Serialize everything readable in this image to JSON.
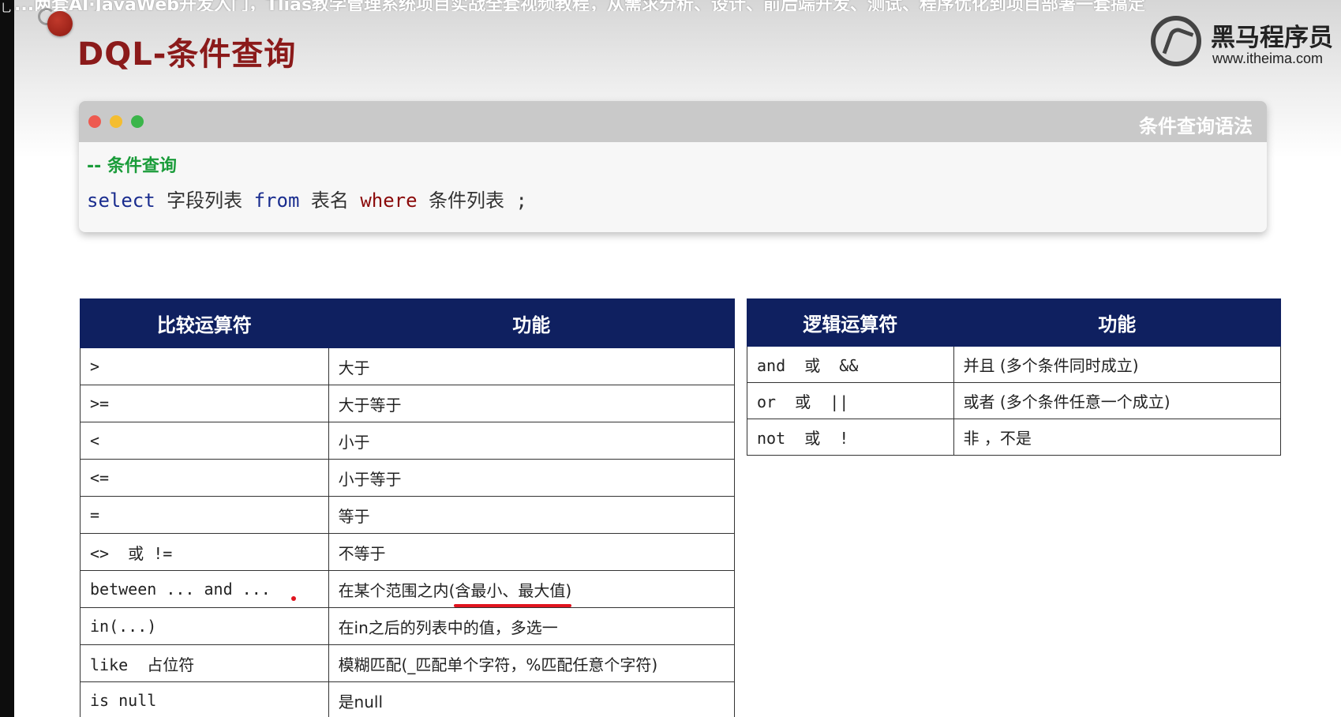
{
  "overlay_caption": "...两套AI·JavaWeb开发入门，Tlias教学管理系统项目实战全套视频教程，从需求分析、设计、前后端开发、测试、程序优化到项目部署一套搞定",
  "left_bar_glyph": "乚",
  "slide": {
    "title": "DQL-条件查询",
    "logo": {
      "name": "黑马程序员",
      "url": "www.itheima.com"
    }
  },
  "code_window": {
    "title": "条件查询语法",
    "comment": "-- 条件查询",
    "tokens": {
      "select": "select",
      "fields": "字段列表",
      "from": "from",
      "table": "表名",
      "where": "where",
      "conditions": "条件列表",
      "semicolon": ";"
    }
  },
  "comparison_table": {
    "headers": [
      "比较运算符",
      "功能"
    ],
    "rows": [
      [
        ">",
        "大于"
      ],
      [
        ">=",
        "大于等于"
      ],
      [
        "<",
        "小于"
      ],
      [
        "<=",
        "小于等于"
      ],
      [
        "=",
        "等于"
      ],
      [
        "<>  或 !=",
        "不等于"
      ],
      [
        "between ... and ...",
        "在某个范围之内"
      ],
      [
        "in(...)",
        "在in之后的列表中的值，多选一"
      ],
      [
        "like  占位符",
        "模糊匹配(_匹配单个字符，%匹配任意个字符)"
      ],
      [
        "is null",
        "是null"
      ]
    ],
    "between_note": "(含最小、最大值)"
  },
  "logic_table": {
    "headers": [
      "逻辑运算符",
      "功能"
    ],
    "rows": [
      [
        "and  或  &&",
        "并且 (多个条件同时成立)"
      ],
      [
        "or  或  ||",
        "或者 (多个条件任意一个成立)"
      ],
      [
        "not  或  !",
        "非 ，不是"
      ]
    ]
  },
  "colors": {
    "table_header": "#0f2060",
    "title_red": "#8b1a1a",
    "keyword_blue": "#1a2d8f",
    "keyword_red": "#8b0a0a",
    "comment_green": "#1a9c3a",
    "annotation_red": "#e0141e"
  }
}
